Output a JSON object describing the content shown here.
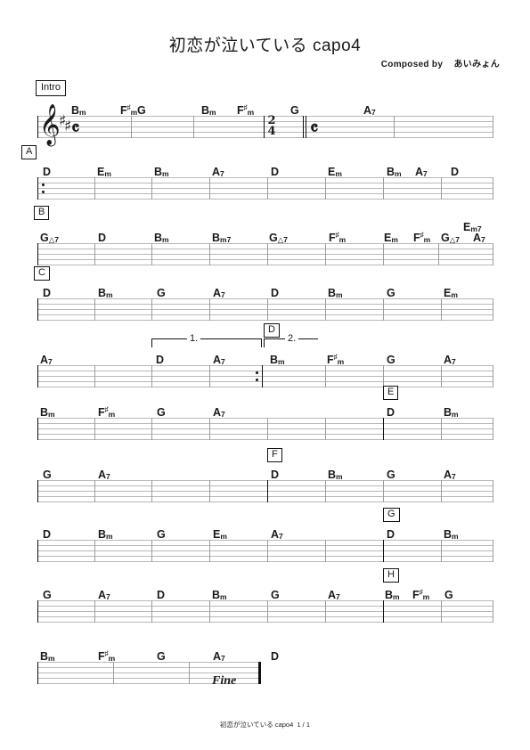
{
  "document": {
    "title": "初恋が泣いている capo4",
    "composer_label": "Composed by    あいみょん",
    "footer": "初恋が泣いている capo4  1 / 1",
    "fine": "Fine",
    "key_signature": "2 sharps (D major)",
    "clef": "treble",
    "time_signatures": [
      "C",
      "2/4",
      "C"
    ]
  },
  "marks": {
    "intro": "Intro",
    "a": "A",
    "b": "B",
    "c": "C",
    "d": "D",
    "e": "E",
    "f": "F",
    "g": "G",
    "h": "H"
  },
  "voltas": {
    "first": "1.",
    "second": "2."
  },
  "systems": [
    {
      "name": "intro-system",
      "chords": [
        "Bm",
        "F#m",
        "G",
        "Bm",
        "F#m",
        "G",
        "A7"
      ]
    },
    {
      "name": "section-a-system",
      "chords": [
        "D",
        "Em",
        "Bm",
        "A7",
        "D",
        "Em",
        "Bm",
        "A7",
        "D"
      ]
    },
    {
      "name": "section-b-system",
      "chords": [
        "G△7",
        "D",
        "Bm",
        "Bm7",
        "G△7",
        "F#m",
        "Em",
        "F#m",
        "G△7",
        "Em7",
        "A7"
      ]
    },
    {
      "name": "section-c-system",
      "chords": [
        "D",
        "Bm",
        "G",
        "A7",
        "D",
        "Bm",
        "G",
        "Em"
      ]
    },
    {
      "name": "volta-system",
      "chords": [
        "A7",
        "D",
        "A7",
        "Bm",
        "F#m",
        "G",
        "A7"
      ]
    },
    {
      "name": "section-e-system",
      "chords": [
        "Bm",
        "F#m",
        "G",
        "A7",
        "D",
        "Bm"
      ]
    },
    {
      "name": "section-f-system",
      "chords": [
        "G",
        "A7",
        "D",
        "Bm",
        "G",
        "A7"
      ]
    },
    {
      "name": "section-g-system",
      "chords": [
        "D",
        "Bm",
        "G",
        "Em",
        "A7",
        "D",
        "Bm"
      ]
    },
    {
      "name": "section-h-system",
      "chords": [
        "G",
        "A7",
        "D",
        "Bm",
        "G",
        "A7",
        "Bm",
        "F#m",
        "G"
      ]
    },
    {
      "name": "final-system",
      "chords": [
        "Bm",
        "F#m",
        "G",
        "A7",
        "D"
      ]
    }
  ],
  "chord_labels": {
    "bm": "B",
    "bm_s": "m",
    "fsm": "F",
    "fsm_sh": "♯",
    "fsm_s": "m",
    "g": "G",
    "a7": "A",
    "a7_s": "7",
    "d": "D",
    "em": "E",
    "em_s": "m",
    "bm7": "B",
    "bm7_s": "m7",
    "gmaj7": "G",
    "gmaj7_tri": "△",
    "gmaj7_s": "7",
    "em7": "E",
    "em7_s": "m7"
  }
}
